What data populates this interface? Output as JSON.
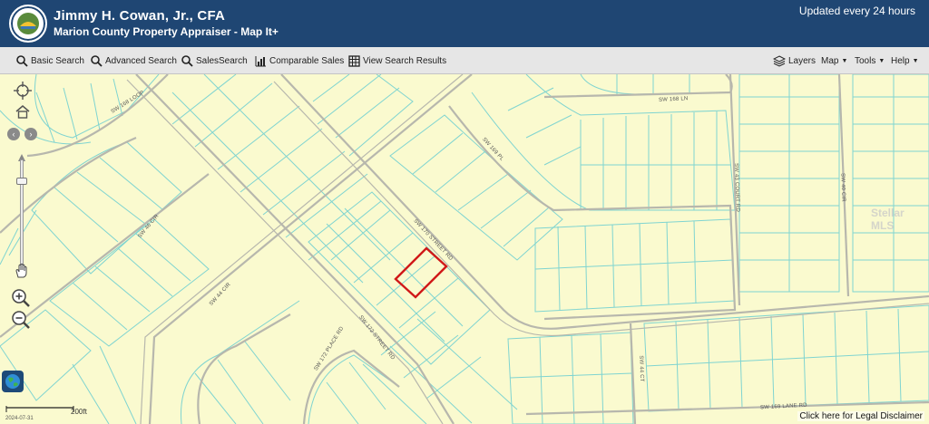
{
  "header": {
    "title": "Jimmy H. Cowan, Jr., CFA",
    "subtitle": "Marion County Property Appraiser - Map It+",
    "updated": "Updated every 24 hours",
    "seal_text": "PROPERTY APPRAISER"
  },
  "toolbar": {
    "basic_search": "Basic Search",
    "advanced_search": "Advanced Search",
    "sales_search": "SalesSearch",
    "comparable_sales": "Comparable Sales",
    "view_results": "View Search Results",
    "layers": "Layers",
    "map": "Map",
    "tools": "Tools",
    "help": "Help"
  },
  "map": {
    "streets": {
      "loop": "SW 168 LOOP",
      "sw168ln": "SW 168 LN",
      "sw169pl": "SW 169 PL",
      "sw170": "SW 170 STREET RD",
      "sw43court": "SW 43 COURT RD",
      "sw40cir": "SW 40 CIR",
      "sw46cir": "SW 46 CIR",
      "sw44cir": "SW 44 CIR",
      "sw172": "SW 172 STREET RD",
      "sw172place": "SW 172 PLACE RD",
      "sw44ct": "SW 44 CT",
      "sw169lane": "SW 169 LANE RD"
    },
    "scale_label": "200ft",
    "date": "2024-07-31",
    "disclaimer": "Click here for Legal Disclaimer",
    "watermark": "Stellar MLS",
    "colors": {
      "header_bg": "#1f4673",
      "map_bg": "#fafacf",
      "parcel_line": "#7fd4d0",
      "road": "#b8b8b0",
      "highlight": "#d01818"
    }
  }
}
